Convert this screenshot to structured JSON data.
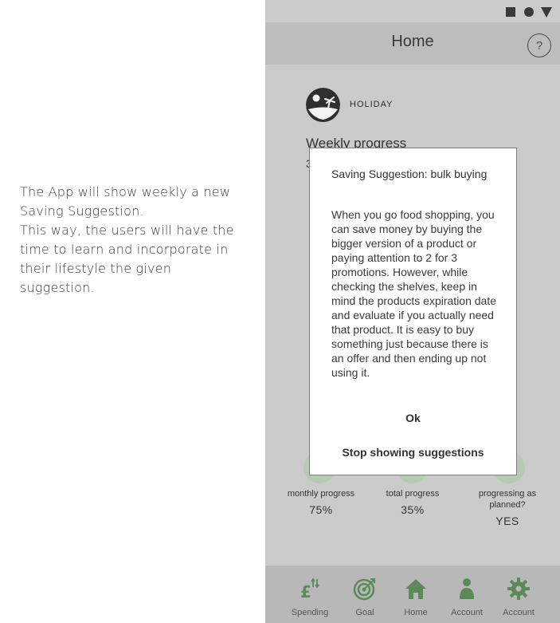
{
  "annotation": {
    "lines": [
      "The App will show weekly a new Saving Suggestion.",
      "This way, the users will have the time to learn and incorporate in their lifestyle the given suggestion."
    ]
  },
  "header": {
    "title": "Home",
    "help_label": "?"
  },
  "goal": {
    "name": "HOLIDAY"
  },
  "weekly": {
    "title": "Weekly progress",
    "peek": "3"
  },
  "stats": [
    {
      "label": "monthly progress",
      "value": "75%"
    },
    {
      "label": "total progress",
      "value": "35%"
    },
    {
      "label": "progressing as planned?",
      "value": "YES"
    }
  ],
  "dialog": {
    "title": "Saving Suggestion: bulk buying",
    "body": "When you go food shopping, you can save money by buying the bigger version of a product or paying attention to 2 for 3 promotions. However, while checking the shelves, keep in mind the products expiration date and evaluate if you actually need that product. It is easy to buy something just because there is an offer and then ending up not using it.",
    "ok_label": "Ok",
    "stop_label": "Stop showing suggestions"
  },
  "nav": {
    "items": [
      {
        "label": "Spending",
        "icon": "pound-transfer-icon"
      },
      {
        "label": "Goal",
        "icon": "target-icon"
      },
      {
        "label": "Home",
        "icon": "home-icon"
      },
      {
        "label": "Account",
        "icon": "person-icon"
      },
      {
        "label": "Account",
        "icon": "gear-icon"
      }
    ]
  },
  "colors": {
    "accent": "#5b8a58",
    "background": "#cbcbcb",
    "dialog": "#ffffff"
  }
}
